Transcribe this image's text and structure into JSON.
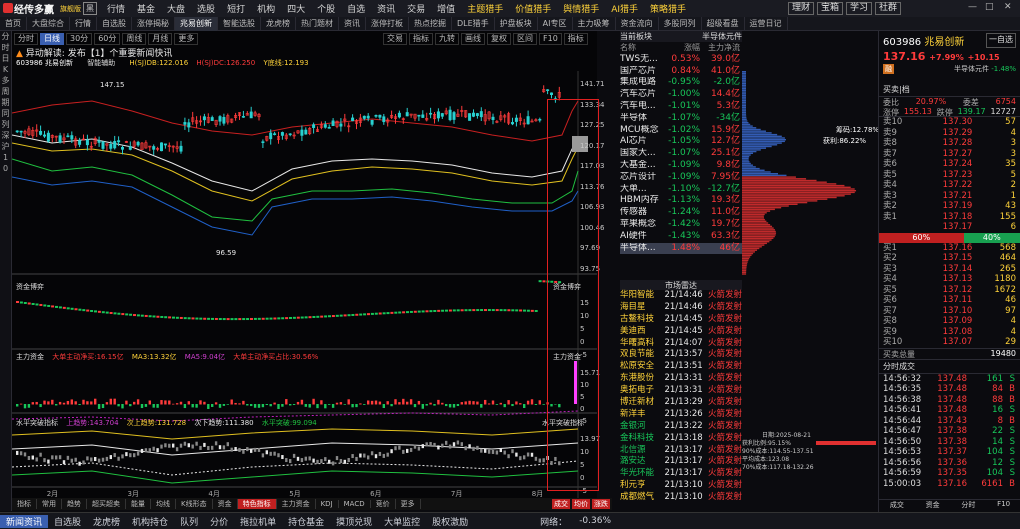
{
  "app": {
    "title": "经传多赢",
    "badge": "旗舰版",
    "badge2": "黑"
  },
  "menu": [
    "行情",
    "基金",
    "大盘",
    "选股",
    "短打",
    "机构",
    "四大",
    "个股",
    "自选",
    "资讯",
    "交易",
    "增值"
  ],
  "menu_promo": [
    "主题猎手",
    "价值猎手",
    "舆情猎手",
    "AI猎手",
    "策略猎手"
  ],
  "menu_right": [
    "理财",
    "宝箱",
    "学习",
    "社群"
  ],
  "tabs": [
    "首页",
    "大盘综合",
    "行情",
    "自选股",
    "涨停揭秘",
    "兆易创新",
    "智能选股",
    "龙虎榜",
    "热门题材",
    "资讯",
    "涨停打板",
    "热点挖掘",
    "DLE猎手",
    "护盘板块",
    "AI专区",
    "主力吸筹",
    "资金流向",
    "多股同列",
    "超级看盘",
    "运营日记"
  ],
  "left_sidebar": [
    "分",
    "时",
    "日",
    "K",
    "多",
    "周",
    "期",
    "同",
    "列",
    "深",
    "沪",
    "1",
    "0"
  ],
  "chart": {
    "period_tabs": [
      "分时",
      "日线",
      "30分",
      "60分",
      "周线",
      "月线",
      "更多"
    ],
    "toolbar2": [
      "交易",
      "指标",
      "九转",
      "画线",
      "复权",
      "区间",
      "F10",
      "指标"
    ],
    "alert": "异动解读: 发布【1】个重要新闻快讯",
    "stock_label": "603986 兆易创新",
    "indicator": "智能辅助",
    "ma": "H(SJ)DB:122.016",
    "ma2": "H(SJ)DC:126.250",
    "ma3": "Y底线:12.193",
    "y_prices": [
      "141.71",
      "133.34",
      "127.25",
      "120.17",
      "117.03",
      "113.76",
      "106.93",
      "100.46",
      "97.69",
      "93.75"
    ],
    "low_label": "96.59",
    "high_label": "147.15",
    "sub1": {
      "title": "资金博弈",
      "values": [
        "15",
        "10",
        "5",
        "0",
        "-5"
      ]
    },
    "sub2": {
      "title": "主力资金",
      "items": [
        "大单主动净买:16.15亿",
        "MA3:13.32亿",
        "MA5:9.04亿",
        "大单主动净买占比:30.56%"
      ],
      "values": [
        "15.71",
        "10",
        "5",
        "0",
        "-5"
      ]
    },
    "sub3": {
      "title": "水平突破指标",
      "items": [
        "上趋势:143.704",
        "次上趋势:131.728",
        "次下趋势:111.380",
        "水平突破:99.094"
      ],
      "values": [
        "13.97",
        "10",
        "5",
        "0",
        "-5"
      ]
    },
    "x_labels": [
      "2月",
      "3月",
      "4月",
      "5月",
      "6月",
      "7月",
      "8月"
    ],
    "bottom_tabs": [
      "指标",
      "常用",
      "趋势",
      "超买超卖",
      "能量",
      "均线",
      "K线形态",
      "资金",
      "特色指标",
      "主力资金",
      "KDJ",
      "MACD",
      "竞价",
      "更多"
    ],
    "right_btns": [
      "成交",
      "均价",
      "涨跌"
    ]
  },
  "sector": {
    "title": "当前板块",
    "header": "半导体元件",
    "cols": [
      "名称",
      "涨幅",
      "主力净流"
    ],
    "rows": [
      [
        "TWS无...",
        "0.53%",
        "39.0亿"
      ],
      [
        "国产芯片",
        "0.84%",
        "41.0亿"
      ],
      [
        "集成电路",
        "-0.95%",
        "-2.0亿"
      ],
      [
        "汽车芯片",
        "-1.00%",
        "14.4亿"
      ],
      [
        "汽车电...",
        "-1.01%",
        "5.3亿"
      ],
      [
        "半导体",
        "-1.07%",
        "-34亿"
      ],
      [
        "MCU概念",
        "-1.02%",
        "15.9亿"
      ],
      [
        "AI芯片",
        "-1.05%",
        "12.7亿"
      ],
      [
        "国家大...",
        "-1.07%",
        "25.1亿"
      ],
      [
        "大基金...",
        "-1.09%",
        "9.8亿"
      ],
      [
        "芯片设计",
        "-1.09%",
        "7.95亿"
      ],
      [
        "大单...",
        "-1.10%",
        "-12.7亿"
      ],
      [
        "HBM内存",
        "-1.13%",
        "19.3亿"
      ],
      [
        "传感器",
        "-1.24%",
        "11.0亿"
      ],
      [
        "苹果概念",
        "-1.42%",
        "19.7亿"
      ],
      [
        "AI硬件",
        "-1.43%",
        "63.3亿"
      ],
      [
        "半导体...",
        "1.48%",
        "46亿"
      ]
    ]
  },
  "news": {
    "title": "市场雷达",
    "rows": [
      [
        "华阳智能",
        "21/14:46",
        "火箭发射"
      ],
      [
        "海目星",
        "21/14:46",
        "火箭发射"
      ],
      [
        "古鳌科技",
        "21/14:45",
        "火箭发射"
      ],
      [
        "美迪西",
        "21/14:45",
        "火箭发射"
      ],
      [
        "华曙高科",
        "21/14:07",
        "火箭发射"
      ],
      [
        "双良节能",
        "21/13:57",
        "火箭发射"
      ],
      [
        "松原安全",
        "21/13:51",
        "火箭发射"
      ],
      [
        "东港股份",
        "21/13:31",
        "火箭发射"
      ],
      [
        "奥拓电子",
        "21/13:31",
        "火箭发射"
      ],
      [
        "博迁新材",
        "21/13:29",
        "火箭发射"
      ],
      [
        "新洋丰",
        "21/13:26",
        "火箭发射"
      ],
      [
        "金银河",
        "21/13:22",
        "火箭发射"
      ],
      [
        "金科科技",
        "21/13:18",
        "火箭发射"
      ],
      [
        "北信源",
        "21/13:17",
        "火箭发射"
      ],
      [
        "潞安达",
        "21/13:17",
        "火箭发射"
      ],
      [
        "华光环能",
        "21/13:17",
        "火箭发射"
      ],
      [
        "利元亨",
        "21/13:10",
        "火箭发射"
      ],
      [
        "成都燃气",
        "21/13:10",
        "火箭发射"
      ]
    ]
  },
  "chip": {
    "l1": "筹码:12.78%",
    "l2": "获利:86.22%",
    "date": "日期:2025-08-21",
    "p1": "获利比例:95.15%",
    "p2": "90%成本:114.55-137.51",
    "p3": "平均成本:123.08",
    "p4": "70%成本:117.18-132.26"
  },
  "quote": {
    "code": "603986",
    "name": "兆易创新",
    "right": "一自选",
    "price": "137.16",
    "chg": "+7.99%",
    "chg2": "+10.15",
    "tag": "融",
    "tag2": "半导体元件",
    "tag2v": "-1.48%",
    "buy_sell": "买卖|档",
    "stats": [
      [
        "委比",
        "20.97%",
        "委差",
        "6754"
      ],
      [
        "涨停",
        "155.13",
        "跌停",
        "139.17",
        "12727"
      ]
    ],
    "asks": [
      [
        "卖10",
        "137.30",
        "57"
      ],
      [
        "卖9",
        "137.29",
        "4"
      ],
      [
        "卖8",
        "137.28",
        "3"
      ],
      [
        "卖7",
        "137.27",
        "3"
      ],
      [
        "卖6",
        "137.24",
        "35"
      ],
      [
        "卖5",
        "137.23",
        "5"
      ],
      [
        "卖4",
        "137.22",
        "2"
      ],
      [
        "卖3",
        "137.21",
        "1"
      ],
      [
        "卖2",
        "137.19",
        "43"
      ],
      [
        "卖1",
        "137.18",
        "155"
      ],
      [
        "",
        "137.17",
        "6"
      ]
    ],
    "ratio": [
      "60%",
      "40%"
    ],
    "bids": [
      [
        "买1",
        "137.16",
        "568"
      ],
      [
        "买2",
        "137.15",
        "464"
      ],
      [
        "买3",
        "137.14",
        "265"
      ],
      [
        "买4",
        "137.13",
        "1180"
      ],
      [
        "买5",
        "137.12",
        "1672"
      ],
      [
        "买6",
        "137.11",
        "46"
      ],
      [
        "买7",
        "137.10",
        "97"
      ],
      [
        "买8",
        "137.09",
        "4"
      ],
      [
        "买9",
        "137.08",
        "4"
      ],
      [
        "买10",
        "137.07",
        "29"
      ]
    ],
    "total_label": "买卖总量",
    "total": "19480",
    "ticks_title": "分时成交",
    "ticks": [
      [
        "14:56:32",
        "137.48",
        "161",
        "S"
      ],
      [
        "14:56:35",
        "137.48",
        "84",
        "B"
      ],
      [
        "14:56:38",
        "137.48",
        "88",
        "B"
      ],
      [
        "14:56:41",
        "137.48",
        "16",
        "S"
      ],
      [
        "14:56:44",
        "137.43",
        "8",
        "B"
      ],
      [
        "14:56:47",
        "137.38",
        "22",
        "S"
      ],
      [
        "14:56:50",
        "137.38",
        "14",
        "S"
      ],
      [
        "14:56:53",
        "137.37",
        "104",
        "S"
      ],
      [
        "14:56:56",
        "137.36",
        "12",
        "S"
      ],
      [
        "14:56:59",
        "137.35",
        "104",
        "S"
      ],
      [
        "15:00:03",
        "137.16",
        "6161",
        "B"
      ]
    ],
    "bottom": [
      "成交",
      "资金",
      "分时",
      "F10"
    ]
  },
  "status": {
    "items": [
      "新闻资讯",
      "自选股",
      "龙虎榜",
      "机构持仓",
      "队列",
      "分价",
      "拖拉机单",
      "持仓基金",
      "摸顶兑现",
      "大单监控",
      "股权激励"
    ],
    "net": "网络：",
    "idx": "-0.36%"
  }
}
